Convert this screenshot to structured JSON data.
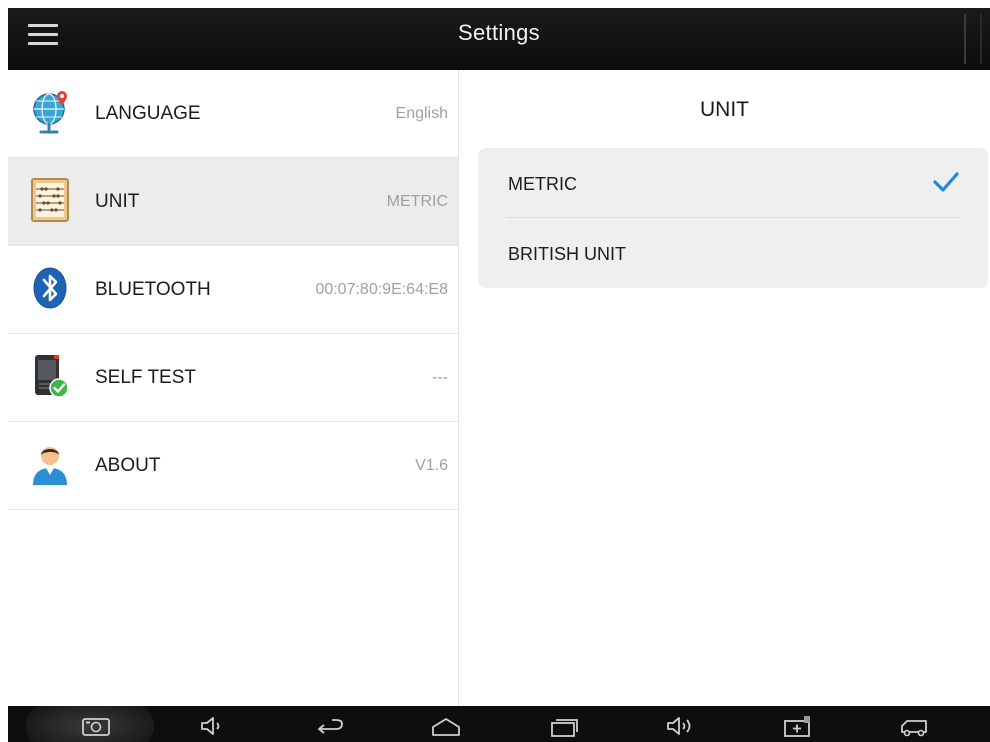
{
  "header": {
    "title": "Settings",
    "menu_icon": "hamburger-icon"
  },
  "settings": {
    "items": [
      {
        "label": "LANGUAGE",
        "value": "English",
        "icon": "globe-icon"
      },
      {
        "label": "UNIT",
        "value": "METRIC",
        "icon": "abacus-icon",
        "selected": true
      },
      {
        "label": "BLUETOOTH",
        "value": "00:07:80:9E:64:E8",
        "icon": "bluetooth-icon"
      },
      {
        "label": "SELF TEST",
        "value": "---",
        "icon": "device-check-icon"
      },
      {
        "label": "ABOUT",
        "value": "V1.6",
        "icon": "user-icon"
      }
    ]
  },
  "unit_panel": {
    "heading": "UNIT",
    "options": [
      {
        "label": "METRIC",
        "checked": true
      },
      {
        "label": "BRITISH UNIT",
        "checked": false
      }
    ],
    "accent": "#1e88e5"
  },
  "navbar": {
    "buttons": [
      "screenshot-icon",
      "volume-down-icon",
      "back-icon",
      "home-icon",
      "recent-apps-icon",
      "volume-up-icon",
      "battery-icon",
      "vehicle-icon"
    ]
  }
}
